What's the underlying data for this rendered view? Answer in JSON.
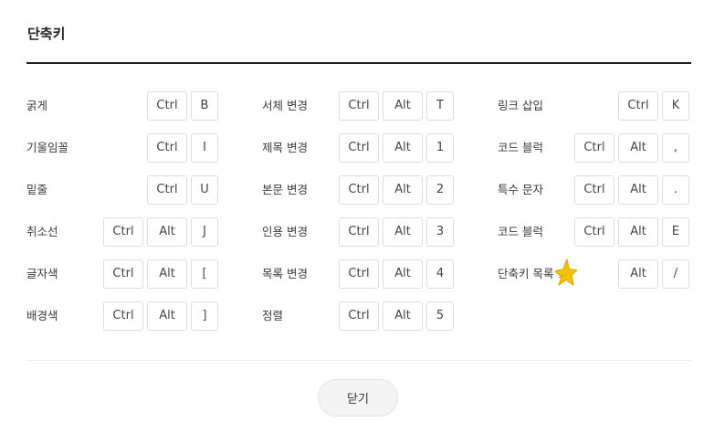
{
  "dialog": {
    "title": "단축키",
    "close_label": "닫기"
  },
  "shortcuts": {
    "col1": [
      {
        "label": "굵게",
        "keys": [
          "Ctrl",
          "B"
        ]
      },
      {
        "label": "기울임꼴",
        "keys": [
          "Ctrl",
          "I"
        ]
      },
      {
        "label": "밑줄",
        "keys": [
          "Ctrl",
          "U"
        ]
      },
      {
        "label": "취소선",
        "keys": [
          "Ctrl",
          "Alt",
          "J"
        ]
      },
      {
        "label": "글자색",
        "keys": [
          "Ctrl",
          "Alt",
          "["
        ]
      },
      {
        "label": "배경색",
        "keys": [
          "Ctrl",
          "Alt",
          "]"
        ]
      }
    ],
    "col2": [
      {
        "label": "서체 변경",
        "keys": [
          "Ctrl",
          "Alt",
          "T"
        ]
      },
      {
        "label": "제목 변경",
        "keys": [
          "Ctrl",
          "Alt",
          "1"
        ]
      },
      {
        "label": "본문 변경",
        "keys": [
          "Ctrl",
          "Alt",
          "2"
        ]
      },
      {
        "label": "인용 변경",
        "keys": [
          "Ctrl",
          "Alt",
          "3"
        ]
      },
      {
        "label": "목록 변경",
        "keys": [
          "Ctrl",
          "Alt",
          "4"
        ]
      },
      {
        "label": "정렬",
        "keys": [
          "Ctrl",
          "Alt",
          "5"
        ]
      }
    ],
    "col3": [
      {
        "label": "링크 삽입",
        "keys": [
          "Ctrl",
          "K"
        ]
      },
      {
        "label": "코드 블럭",
        "keys": [
          "Ctrl",
          "Alt",
          ","
        ]
      },
      {
        "label": "특수 문자",
        "keys": [
          "Ctrl",
          "Alt",
          "."
        ]
      },
      {
        "label": "코드 블럭",
        "keys": [
          "Ctrl",
          "Alt",
          "E"
        ]
      },
      {
        "label": "단축키 목록",
        "keys": [
          "Alt",
          "/"
        ]
      }
    ]
  },
  "colors": {
    "star": "#f5c400",
    "rule": "#1e1e1e"
  },
  "icons": {
    "star": "star-icon"
  }
}
